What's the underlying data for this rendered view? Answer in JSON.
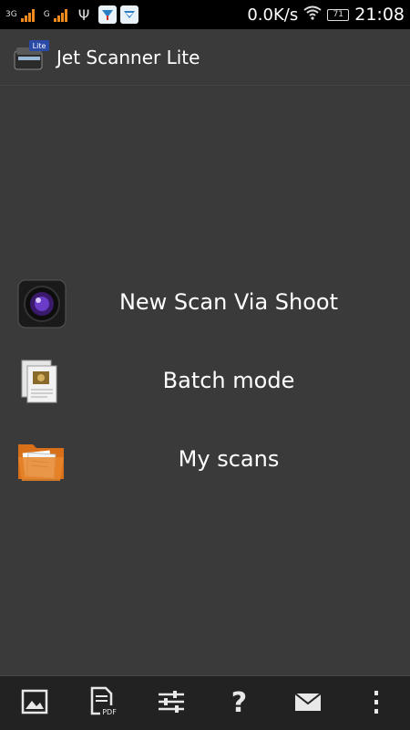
{
  "statusbar": {
    "network1": "3G",
    "network2": "G",
    "speed": "0.0K/s",
    "battery": "71",
    "time": "21:08"
  },
  "app": {
    "title": "Jet Scanner Lite",
    "badge": "Lite"
  },
  "menu": {
    "items": [
      {
        "label": "New Scan Via Shoot",
        "icon": "camera-lens-icon"
      },
      {
        "label": "Batch mode",
        "icon": "documents-icon"
      },
      {
        "label": "My scans",
        "icon": "folder-icon"
      }
    ]
  },
  "bottombar": {
    "buttons": [
      {
        "icon": "image-icon"
      },
      {
        "icon": "pdf-document-icon",
        "badge": "PDF"
      },
      {
        "icon": "settings-sliders-icon"
      },
      {
        "icon": "help-icon",
        "glyph": "?"
      },
      {
        "icon": "mail-icon"
      },
      {
        "icon": "overflow-menu-icon"
      }
    ]
  },
  "colors": {
    "background": "#3a3a3a",
    "statusbar": "#000000",
    "bottombar": "#222222",
    "signal": "#f08a1c",
    "text": "#ffffff"
  }
}
